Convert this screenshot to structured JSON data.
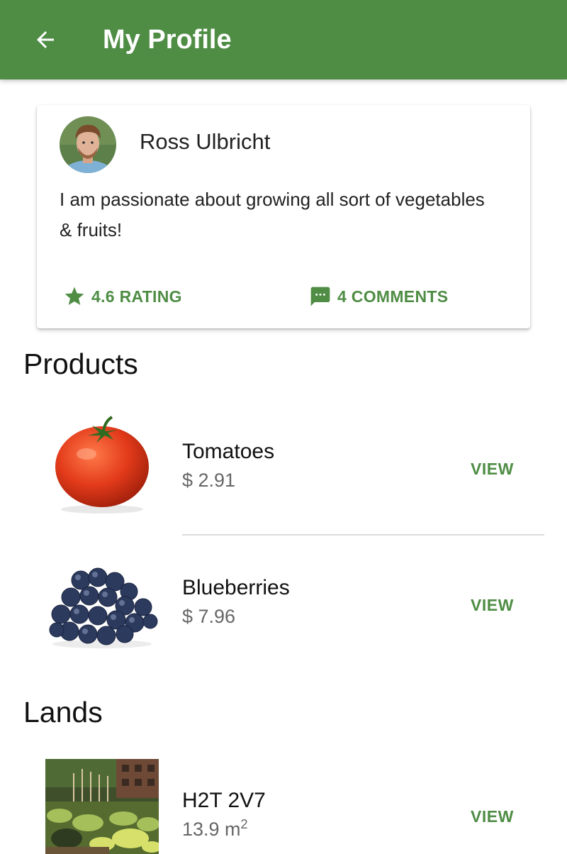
{
  "appbar": {
    "title": "My Profile"
  },
  "profile": {
    "name": "Ross Ulbricht",
    "bio": "I am passionate about growing all sort of vegetables & fruits!",
    "rating_label": "4.6 RATING",
    "comments_label": "4 COMMENTS"
  },
  "products": {
    "title": "Products",
    "items": [
      {
        "name": "Tomatoes",
        "price": "$ 2.91",
        "action": "VIEW",
        "image": "tomato-image"
      },
      {
        "name": "Blueberries",
        "price": "$ 7.96",
        "action": "VIEW",
        "image": "blueberries-image"
      }
    ]
  },
  "lands": {
    "title": "Lands",
    "items": [
      {
        "name": "H2T 2V7",
        "area": "13.9 m",
        "area_unit_exp": "2",
        "action": "VIEW",
        "image": "garden-image"
      }
    ]
  },
  "colors": {
    "primary": "#4f8d45",
    "text": "#222222",
    "secondary_text": "#666666"
  }
}
